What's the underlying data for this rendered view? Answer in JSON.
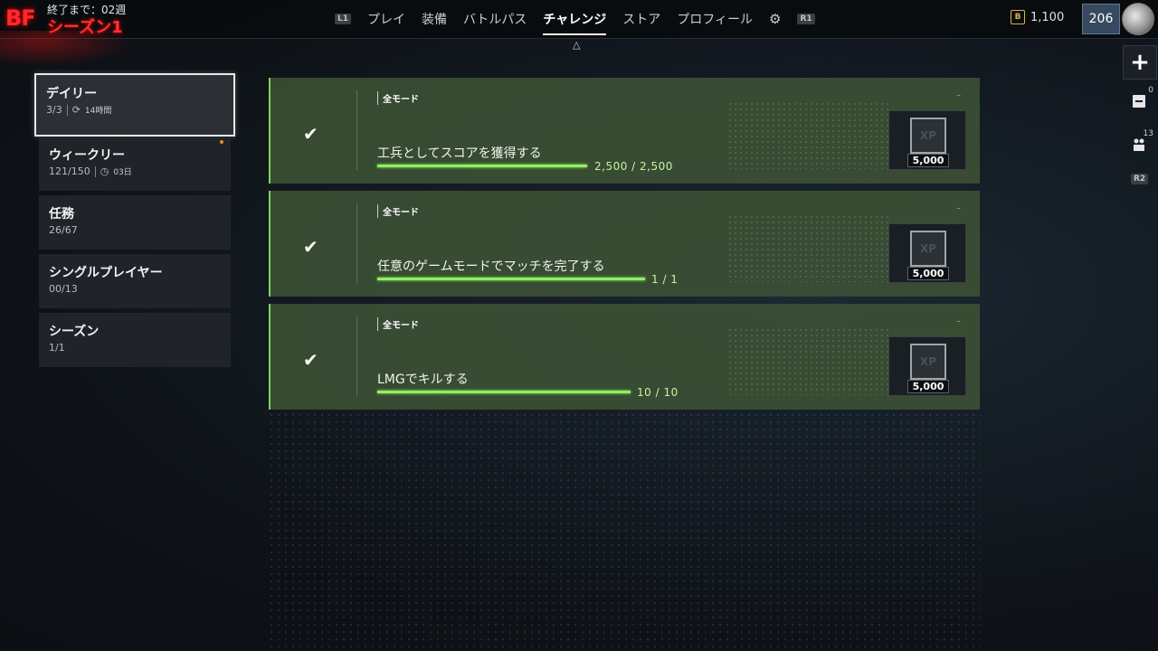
{
  "header": {
    "logo": "BF",
    "season_remaining": "終了まで：02週",
    "season_name": "シーズン1",
    "nav": [
      {
        "type": "button",
        "label": "L1"
      },
      {
        "type": "tab",
        "label": "プレイ"
      },
      {
        "type": "tab",
        "label": "装備"
      },
      {
        "type": "tab",
        "label": "バトルパス"
      },
      {
        "type": "tab",
        "label": "チャレンジ",
        "active": true
      },
      {
        "type": "tab",
        "label": "ストア"
      },
      {
        "type": "tab",
        "label": "プロフィール"
      },
      {
        "type": "icon",
        "label": "gear-icon"
      },
      {
        "type": "button",
        "label": "R1"
      }
    ],
    "currency_icon_label": "B",
    "currency_value": "1,100",
    "player_level": "206"
  },
  "rail": {
    "plus_label": "+",
    "friends_count": "0",
    "party_count": "13",
    "r2_label": "R2"
  },
  "categories": [
    {
      "title": "デイリー",
      "progress": "3/3",
      "timer": "14時間",
      "active": true
    },
    {
      "title": "ウィークリー",
      "progress": "121/150",
      "timer": "03日",
      "notify": true
    },
    {
      "title": "任務",
      "progress": "26/67"
    },
    {
      "title": "シングルプレイヤー",
      "progress": "00/13"
    },
    {
      "title": "シーズン",
      "progress": "1/1"
    }
  ],
  "challenges": [
    {
      "mode": "全モード",
      "title": "工兵としてスコアを獲得する",
      "progress": "2,500 / 2,500",
      "reward": "5,000",
      "completion": 1.0
    },
    {
      "mode": "全モード",
      "title": "任意のゲームモードでマッチを完了する",
      "progress": "1 / 1",
      "reward": "5,000",
      "completion": 1.0
    },
    {
      "mode": "全モード",
      "title": "LMGでキルする",
      "progress": "10 / 10",
      "reward": "5,000",
      "completion": 1.0
    }
  ],
  "reward_label": "XP",
  "colors": {
    "accent_green": "#8ef25a",
    "card_bg": "#3e5436",
    "season_red": "#ff3030",
    "coin_gold": "#e2b046"
  }
}
